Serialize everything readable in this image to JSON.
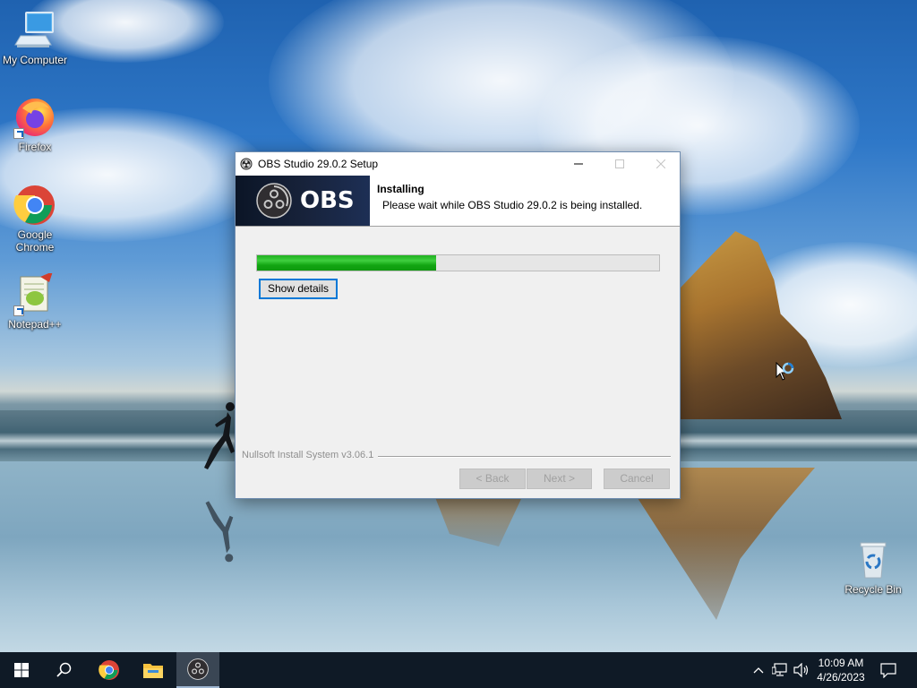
{
  "desktop": {
    "icons": [
      {
        "label": "My Computer"
      },
      {
        "label": "Firefox"
      },
      {
        "label": "Google Chrome"
      },
      {
        "label": "Notepad++"
      },
      {
        "label": "Recycle Bin"
      }
    ]
  },
  "installer": {
    "title": "OBS Studio 29.0.2 Setup",
    "logo_text": "OBS",
    "header_title": "Installing",
    "header_subtitle": "Please wait while OBS Studio 29.0.2 is being installed.",
    "progress": 0.445,
    "show_details_label": "Show details",
    "branding": "Nullsoft Install System v3.06.1",
    "back_label": "< Back",
    "next_label": "Next >",
    "cancel_label": "Cancel"
  },
  "taskbar": {
    "pinned": [
      "start-button",
      "search-icon",
      "chrome-icon",
      "file-explorer-icon",
      "obs-icon"
    ],
    "clock": {
      "time": "10:09 AM",
      "date": "4/26/2023"
    }
  },
  "colors": {
    "progress_fill": "#20b020",
    "taskbar_bg": "#0f1a26",
    "focus_blue": "#0078d7"
  }
}
